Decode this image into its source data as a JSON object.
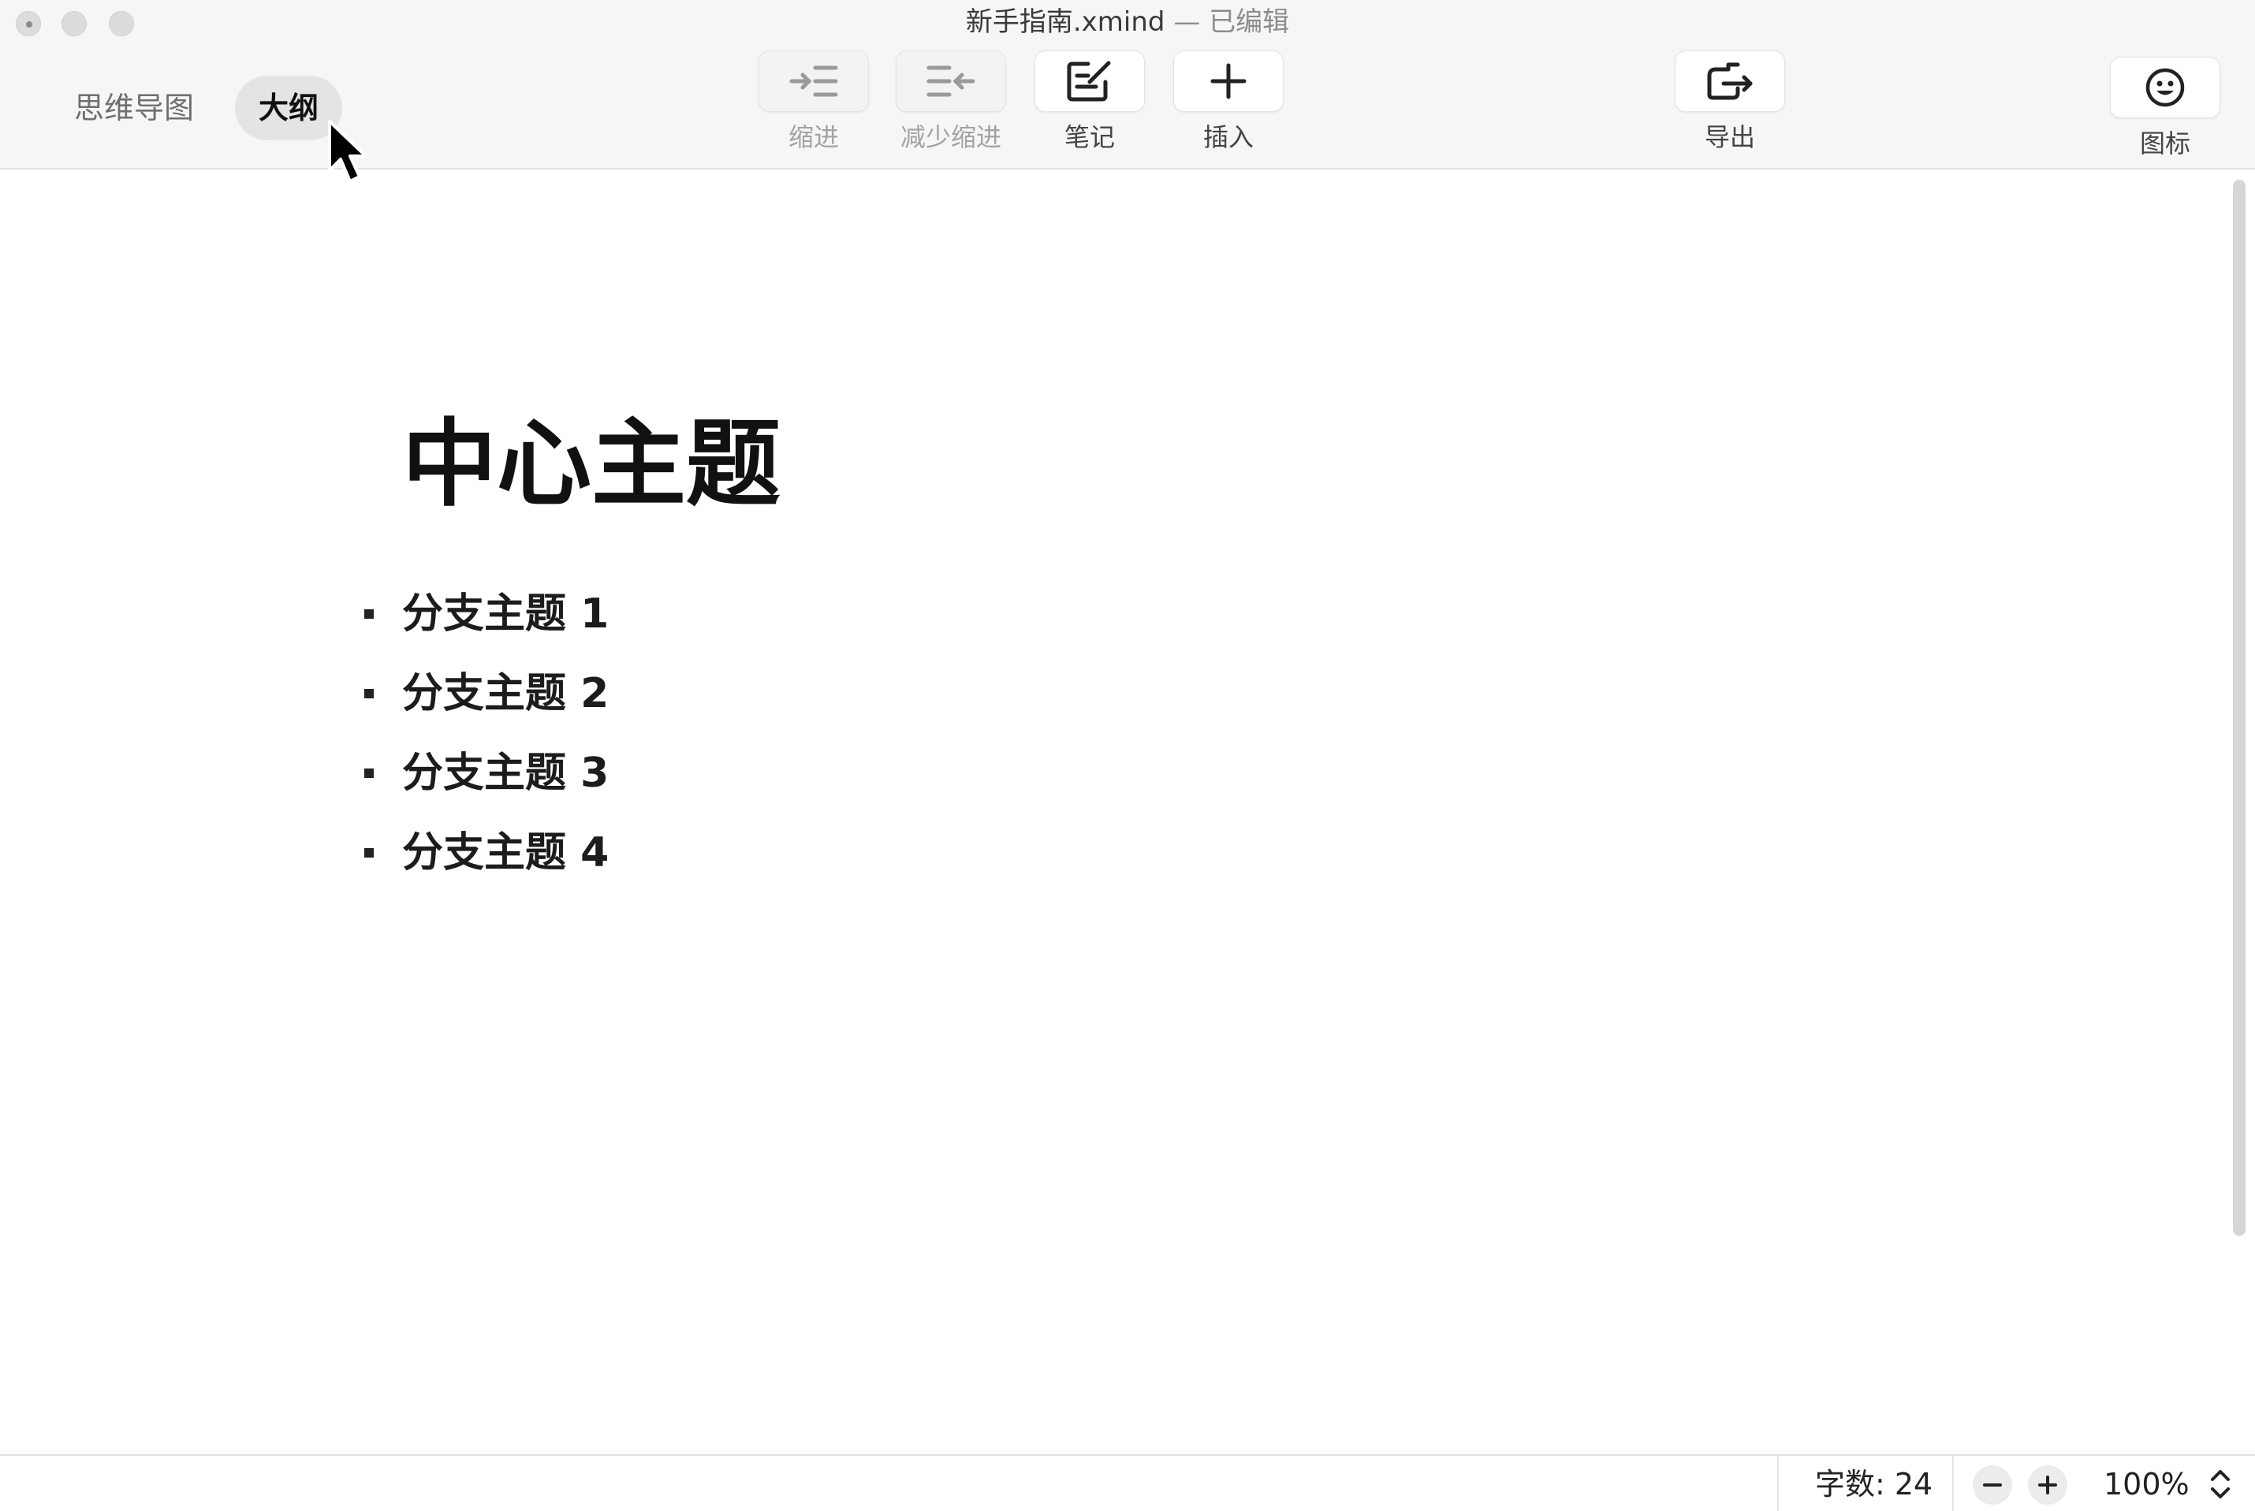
{
  "window": {
    "filename": "新手指南.xmind",
    "edited_status": "— 已编辑"
  },
  "view_switch": {
    "mindmap_label": "思维导图",
    "outline_label": "大纲",
    "active": "outline"
  },
  "toolbar": {
    "indent_label": "缩进",
    "outdent_label": "减少缩进",
    "note_label": "笔记",
    "insert_label": "插入",
    "export_label": "导出",
    "icon_label": "图标"
  },
  "document": {
    "central_topic": "中心主题",
    "branches": [
      {
        "label": "分支主题 1"
      },
      {
        "label": "分支主题 2"
      },
      {
        "label": "分支主题 3"
      },
      {
        "label": "分支主题 4"
      }
    ]
  },
  "statusbar": {
    "word_count": "字数: 24",
    "zoom": "100%"
  },
  "icons": [
    "indent-icon",
    "outdent-icon",
    "note-icon",
    "plus-icon",
    "export-icon",
    "emoji-icon",
    "minus-icon",
    "plus-icon",
    "stepper-icon",
    "mouse-pointer-icon"
  ]
}
